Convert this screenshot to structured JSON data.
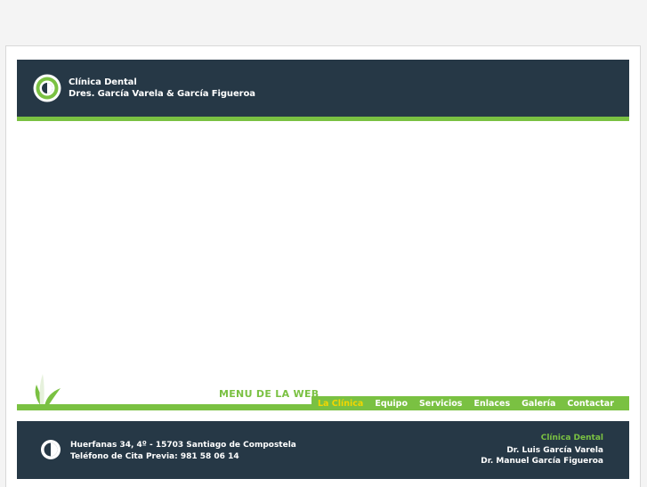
{
  "header": {
    "line1": "Clínica Dental",
    "line2": "Dres. García Varela & García Figueroa"
  },
  "menu": {
    "label": "MENU DE LA WEB",
    "items": [
      {
        "label": "La Clínica",
        "active": true
      },
      {
        "label": "Equipo",
        "active": false
      },
      {
        "label": "Servicios",
        "active": false
      },
      {
        "label": "Enlaces",
        "active": false
      },
      {
        "label": "Galería",
        "active": false
      },
      {
        "label": "Contactar",
        "active": false
      }
    ]
  },
  "footer": {
    "address": "Huerfanas 34, 4º - 15703 Santiago de Compostela",
    "phone": "Teléfono de Cita Previa: 981 58 06 14",
    "clinic": "Clínica Dental",
    "doctor1": "Dr. Luis García Varela",
    "doctor2": "Dr. Manuel García Figueroa"
  },
  "colors": {
    "navy": "#263846",
    "green": "#7ac142",
    "active": "#f2d600"
  },
  "icons": {
    "logo": "clinic-logo-icon",
    "leaf": "leaf-icon",
    "footer_logo": "half-circle-icon"
  }
}
